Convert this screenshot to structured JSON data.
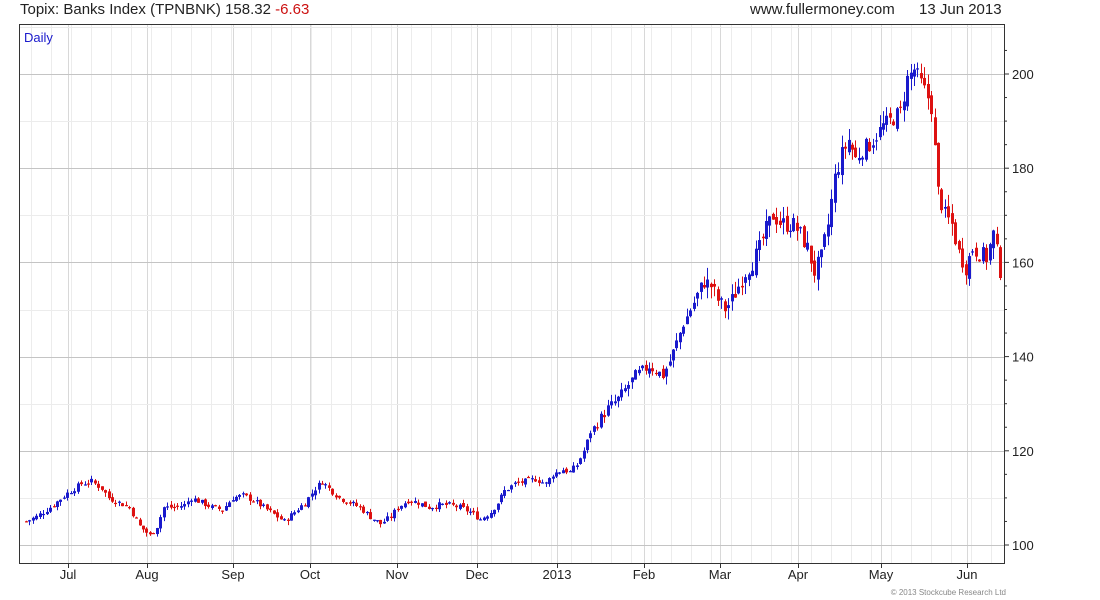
{
  "header": {
    "title": "Topix: Banks Index (TPNBNK) 158.32",
    "change": "-6.63",
    "site": "www.fullermoney.com",
    "date": "13 Jun 2013"
  },
  "footer": {
    "copyright": "© 2013 Stockcube Research Ltd"
  },
  "colors": {
    "up": "#1a1acc",
    "down": "#dd1111",
    "grid": "#d4d4d4",
    "axis": "#333333"
  },
  "chart_data": {
    "type": "candlestick",
    "period_label": "Daily",
    "x_tick_labels": [
      "Jul",
      "Aug",
      "Sep",
      "Oct",
      "Nov",
      "Dec",
      "2013",
      "Feb",
      "Mar",
      "Apr",
      "May",
      "Jun"
    ],
    "y_ticks": [
      100,
      120,
      140,
      160,
      180,
      200
    ],
    "ylim": [
      96,
      210
    ],
    "close_points": [
      [
        0,
        105
      ],
      [
        3,
        106
      ],
      [
        7,
        108
      ],
      [
        12,
        111
      ],
      [
        16,
        113
      ],
      [
        19,
        113.5
      ],
      [
        22,
        112
      ],
      [
        24,
        110
      ],
      [
        27,
        109
      ],
      [
        30,
        108
      ],
      [
        33,
        104
      ],
      [
        36,
        102
      ],
      [
        38,
        104
      ],
      [
        40,
        108
      ],
      [
        43,
        108
      ],
      [
        46,
        108.5
      ],
      [
        48,
        110
      ],
      [
        51,
        109
      ],
      [
        54,
        108
      ],
      [
        57,
        107.5
      ],
      [
        60,
        110
      ],
      [
        63,
        110.5
      ],
      [
        66,
        109.5
      ],
      [
        69,
        108
      ],
      [
        72,
        106.5
      ],
      [
        75,
        105
      ],
      [
        78,
        107
      ],
      [
        81,
        109
      ],
      [
        84,
        112
      ],
      [
        86,
        113.5
      ],
      [
        88,
        112
      ],
      [
        91,
        110
      ],
      [
        94,
        109
      ],
      [
        97,
        108
      ],
      [
        100,
        106
      ],
      [
        103,
        104.5
      ],
      [
        106,
        106
      ],
      [
        108,
        108
      ],
      [
        111,
        109.5
      ],
      [
        114,
        109
      ],
      [
        117,
        108
      ],
      [
        120,
        108.5
      ],
      [
        123,
        108.5
      ],
      [
        126,
        108
      ],
      [
        129,
        107
      ],
      [
        132,
        105.5
      ],
      [
        135,
        107
      ],
      [
        137,
        109
      ],
      [
        139,
        111.5
      ],
      [
        142,
        113
      ],
      [
        145,
        113.5
      ],
      [
        148,
        114
      ],
      [
        151,
        113
      ],
      [
        153,
        115
      ],
      [
        156,
        116
      ],
      [
        158,
        115.5
      ],
      [
        160,
        117
      ],
      [
        162,
        120
      ],
      [
        164,
        124
      ],
      [
        167,
        127
      ],
      [
        169,
        129
      ],
      [
        172,
        131
      ],
      [
        175,
        134
      ],
      [
        177,
        136
      ],
      [
        179,
        137
      ],
      [
        181,
        138
      ],
      [
        183,
        137
      ],
      [
        185,
        136
      ],
      [
        187,
        139
      ],
      [
        189,
        143
      ],
      [
        191,
        147
      ],
      [
        193,
        150
      ],
      [
        195,
        153
      ],
      [
        197,
        156
      ],
      [
        199,
        155
      ],
      [
        201,
        152
      ],
      [
        203,
        150
      ],
      [
        205,
        152
      ],
      [
        207,
        155
      ],
      [
        209,
        158
      ],
      [
        211,
        160
      ],
      [
        213,
        163
      ],
      [
        215,
        167
      ],
      [
        217,
        170
      ],
      [
        219,
        168.5
      ],
      [
        221,
        168
      ],
      [
        223,
        168
      ],
      [
        225,
        166
      ],
      [
        227,
        163
      ],
      [
        229,
        158
      ],
      [
        231,
        161
      ],
      [
        233,
        168
      ],
      [
        235,
        178
      ],
      [
        237,
        183
      ],
      [
        239,
        186
      ],
      [
        241,
        182
      ],
      [
        243,
        184
      ],
      [
        245,
        185
      ],
      [
        247,
        187
      ],
      [
        249,
        189
      ],
      [
        251,
        190
      ],
      [
        254,
        192
      ],
      [
        256,
        199
      ],
      [
        258,
        201
      ],
      [
        260,
        198
      ],
      [
        262,
        195
      ],
      [
        263,
        193
      ],
      [
        265,
        175
      ],
      [
        267,
        170
      ],
      [
        269,
        168
      ],
      [
        271,
        162
      ],
      [
        273,
        159
      ],
      [
        275,
        163
      ],
      [
        277,
        162
      ],
      [
        279,
        161
      ],
      [
        281,
        166
      ],
      [
        283,
        158.3
      ]
    ]
  }
}
